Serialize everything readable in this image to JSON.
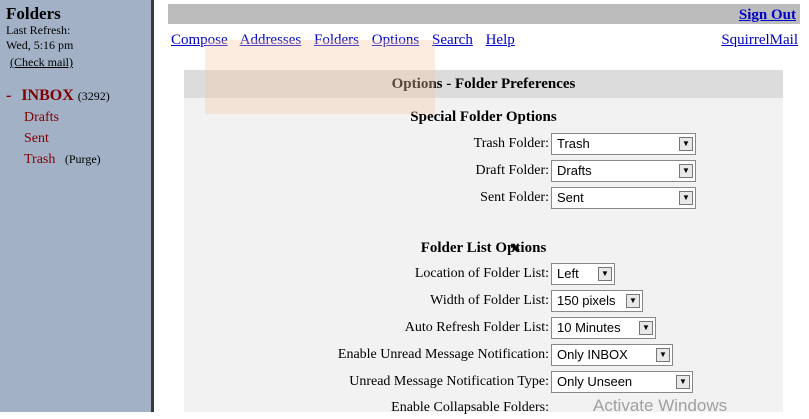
{
  "sidebar": {
    "title": "Folders",
    "last_refresh_label": "Last Refresh:",
    "last_refresh_time": "Wed, 5:16 pm",
    "check_mail": "(Check mail)",
    "folders": [
      {
        "prefix": "-",
        "name": "INBOX",
        "count": "(3292)"
      },
      {
        "name": "Drafts"
      },
      {
        "name": "Sent"
      },
      {
        "name": "Trash",
        "action": "(Purge)"
      }
    ]
  },
  "header": {
    "sign_out": "Sign Out",
    "nav": [
      "Compose",
      "Addresses",
      "Folders",
      "Options",
      "Search",
      "Help"
    ],
    "brand_link": "SquirrelMail"
  },
  "panel": {
    "title": "Options - Folder Preferences",
    "special_section": "Special Folder Options",
    "special_rows": [
      {
        "label": "Trash Folder:",
        "value": "Trash"
      },
      {
        "label": "Draft Folder:",
        "value": "Drafts"
      },
      {
        "label": "Sent Folder:",
        "value": "Sent"
      }
    ],
    "list_section": "Folder List Options",
    "list_rows": [
      {
        "label": "Location of Folder List:",
        "value": "Left"
      },
      {
        "label": "Width of Folder List:",
        "value": "150 pixels"
      },
      {
        "label": "Auto Refresh Folder List:",
        "value": "10 Minutes"
      },
      {
        "label": "Enable Unread Message Notification:",
        "value": "Only INBOX"
      },
      {
        "label": "Unread Message Notification Type:",
        "value": "Only Unseen"
      }
    ],
    "partial_row": "Enable Collapsable Folders:"
  },
  "overlay": {
    "watermark": "Activate Windows"
  }
}
